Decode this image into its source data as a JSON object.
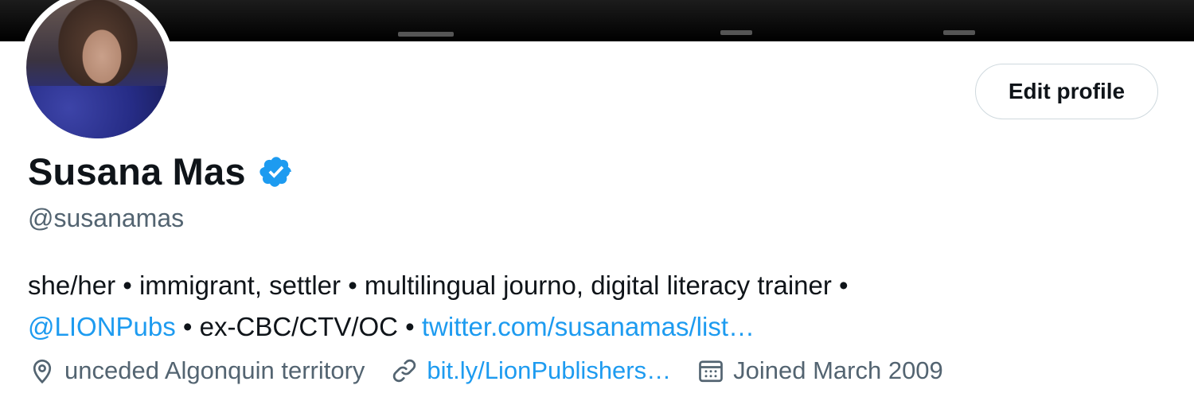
{
  "profile": {
    "name": "Susana Mas",
    "handle": "@susanamas",
    "verified_icon": "verified-badge-icon",
    "edit_button_label": "Edit profile"
  },
  "bio": {
    "line1": "she/her • immigrant, settler • multilingual journo, digital literacy trainer •",
    "mention": "@LIONPubs",
    "sep1": " • ex-CBC/CTV/OC • ",
    "link": "twitter.com/susanamas/list…"
  },
  "meta": {
    "location_icon": "location-pin-icon",
    "location": "unceded Algonquin territory",
    "website_icon": "link-icon",
    "website": "bit.ly/LionPublishers…",
    "joined_icon": "calendar-icon",
    "joined": "Joined March 2009"
  },
  "colors": {
    "accent": "#1d9bf0",
    "secondary_text": "#536471",
    "primary_text": "#0f1419",
    "button_border": "#cfd9de"
  }
}
